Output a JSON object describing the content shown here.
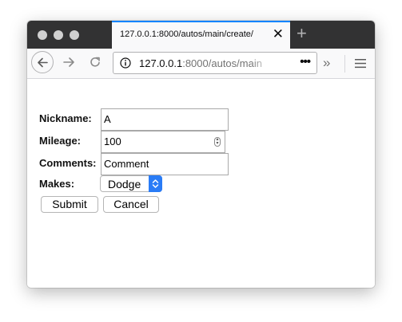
{
  "browser": {
    "tab_title": "127.0.0.1:8000/autos/main/create/",
    "tab_close_glyph": "✕",
    "new_tab_glyph": "+",
    "url_host": "127.0.0.1",
    "url_path": ":8000/autos/main",
    "url_more_glyph": "•••",
    "overflow_glyph": "»",
    "accent_color": "#0a84ff"
  },
  "form": {
    "nickname_label": "Nickname:",
    "nickname_value": "A",
    "mileage_label": "Mileage:",
    "mileage_value": "100",
    "comments_label": "Comments:",
    "comments_value": "Comment",
    "makes_label": "Makes:",
    "makes_selected": "Dodge",
    "submit_label": "Submit",
    "cancel_label": "Cancel"
  },
  "icons": {
    "back": "back-arrow-icon",
    "forward": "forward-arrow-icon",
    "reload": "reload-icon",
    "site_info": "info-icon",
    "menu": "hamburger-menu-icon",
    "select_arrow": "updown-chevron-icon"
  }
}
